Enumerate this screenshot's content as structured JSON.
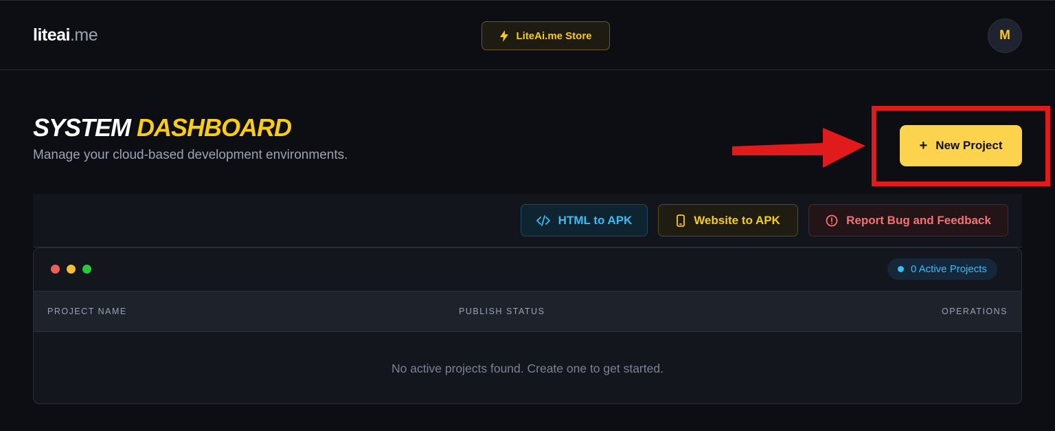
{
  "header": {
    "logo_main": "liteai",
    "logo_suffix": ".me",
    "store_label": "LiteAi.me Store",
    "avatar_initial": "M"
  },
  "hero": {
    "title_part1": "SYSTEM",
    "title_part2": "DASHBOARD",
    "subtitle": "Manage your cloud-based development environments.",
    "new_project_label": "New Project"
  },
  "toolbar": {
    "html_to_apk": "HTML to APK",
    "website_to_apk": "Website to APK",
    "report_bug": "Report Bug and Feedback"
  },
  "panel": {
    "active_projects": "0 Active Projects",
    "columns": [
      "PROJECT NAME",
      "PUBLISH STATUS",
      "OPERATIONS"
    ],
    "empty_message": "No active projects found. Create one to get started."
  },
  "colors": {
    "accent_yellow": "#facc15",
    "accent_blue": "#38bdf8",
    "accent_red": "#f87171",
    "highlight_red": "#e11b1b"
  },
  "icons": [
    "lightning-icon",
    "plus-icon",
    "code-icon",
    "mobile-icon",
    "alert-icon"
  ]
}
